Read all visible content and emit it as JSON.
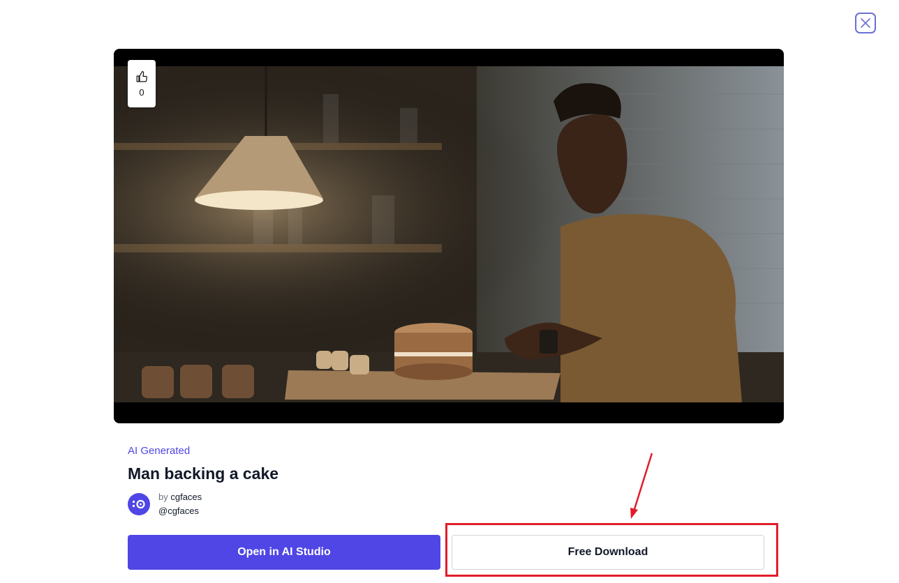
{
  "close": {
    "icon": "close-icon"
  },
  "like": {
    "icon": "thumbs-up-icon",
    "count": "0"
  },
  "asset": {
    "tag": "AI Generated",
    "title": "Man backing a cake",
    "author_prefix": "by",
    "author_name": "cgfaces",
    "author_handle": "@cgfaces"
  },
  "actions": {
    "open_label": "Open in AI Studio",
    "download_label": "Free Download"
  },
  "annotation": {
    "color": "#e11d2a"
  },
  "colors": {
    "accent": "#4f46e5",
    "close_border": "#6b6fd4"
  }
}
